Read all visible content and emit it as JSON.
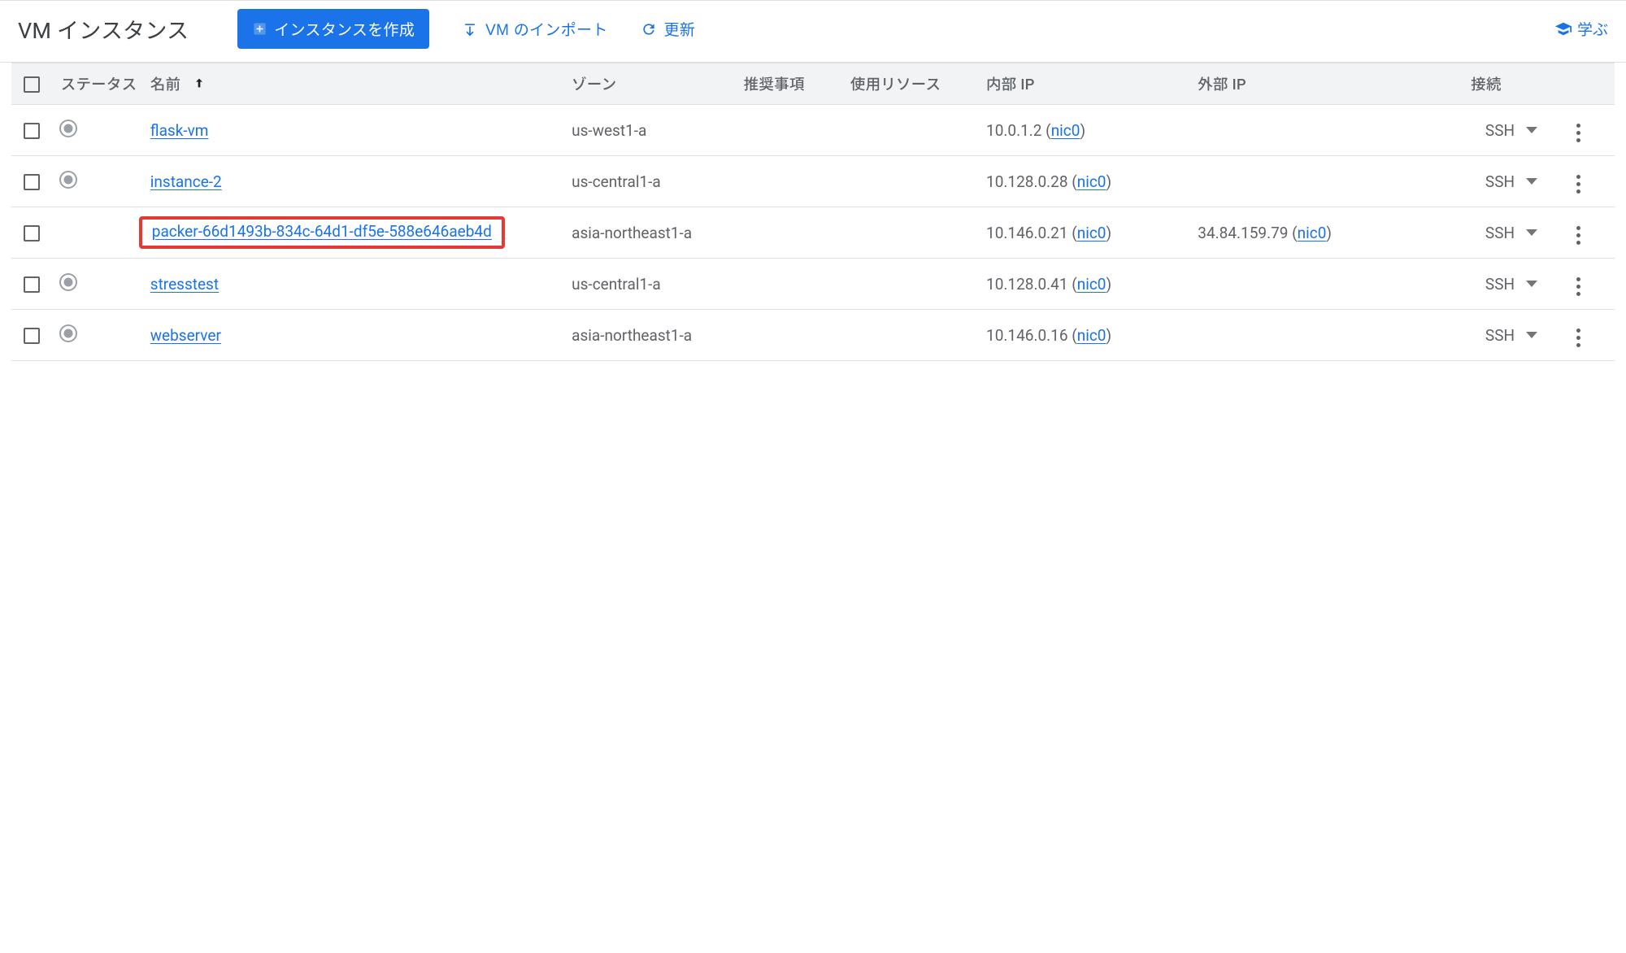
{
  "page": {
    "title": "VM インスタンス"
  },
  "toolbar": {
    "create_label": "インスタンスを作成",
    "import_label": "VM のインポート",
    "refresh_label": "更新",
    "learn_label": "学ぶ"
  },
  "columns": {
    "status": "ステータス",
    "name": "名前",
    "zone": "ゾーン",
    "recommendation": "推奨事項",
    "usage": "使用リソース",
    "internal_ip": "内部 IP",
    "external_ip": "外部 IP",
    "connect": "接続"
  },
  "ssh_label": "SSH",
  "instances": [
    {
      "status": "stopped",
      "name": "flask-vm",
      "zone": "us-west1-a",
      "internal_ip": "10.0.1.2",
      "internal_nic": "nic0",
      "external_ip": "",
      "external_nic": "",
      "highlight": false
    },
    {
      "status": "stopped",
      "name": "instance-2",
      "zone": "us-central1-a",
      "internal_ip": "10.128.0.28",
      "internal_nic": "nic0",
      "external_ip": "",
      "external_nic": "",
      "highlight": false
    },
    {
      "status": "none",
      "name": "packer-66d1493b-834c-64d1-df5e-588e646aeb4d",
      "zone": "asia-northeast1-a",
      "internal_ip": "10.146.0.21",
      "internal_nic": "nic0",
      "external_ip": "34.84.159.79",
      "external_nic": "nic0",
      "highlight": true
    },
    {
      "status": "stopped",
      "name": "stresstest",
      "zone": "us-central1-a",
      "internal_ip": "10.128.0.41",
      "internal_nic": "nic0",
      "external_ip": "",
      "external_nic": "",
      "highlight": false
    },
    {
      "status": "stopped",
      "name": "webserver",
      "zone": "asia-northeast1-a",
      "internal_ip": "10.146.0.16",
      "internal_nic": "nic0",
      "external_ip": "",
      "external_nic": "",
      "highlight": false
    }
  ]
}
